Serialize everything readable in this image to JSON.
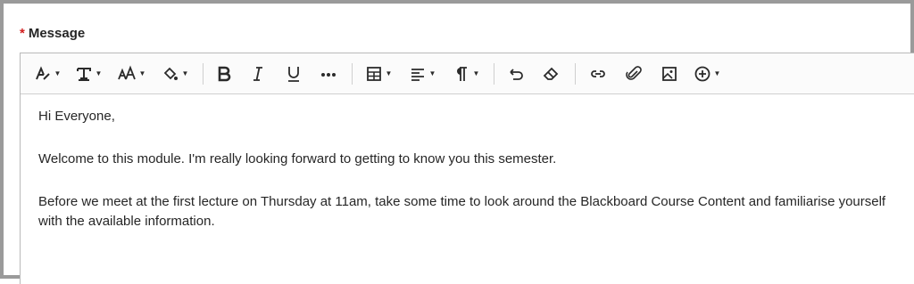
{
  "field": {
    "required_marker": "*",
    "label": "Message"
  },
  "toolbar": {
    "items": [
      {
        "icon": "text-style-icon"
      },
      {
        "icon": "text-format-icon"
      },
      {
        "icon": "font-size-icon"
      },
      {
        "icon": "text-color-icon"
      },
      {
        "icon": "bold-icon"
      },
      {
        "icon": "italic-icon"
      },
      {
        "icon": "underline-icon"
      },
      {
        "icon": "more-icon"
      },
      {
        "icon": "table-icon"
      },
      {
        "icon": "align-icon"
      },
      {
        "icon": "paragraph-icon"
      },
      {
        "icon": "undo-icon"
      },
      {
        "icon": "eraser-icon"
      },
      {
        "icon": "link-icon"
      },
      {
        "icon": "attach-icon"
      },
      {
        "icon": "image-icon"
      },
      {
        "icon": "add-content-icon"
      }
    ]
  },
  "content": {
    "paragraphs": [
      "Hi Everyone,",
      "Welcome to this module. I'm really looking forward to getting to know you this semester.",
      "Before we meet at the first lecture on Thursday at 11am, take some time to look around the Blackboard Course Content and familiarise yourself with the available information."
    ]
  }
}
